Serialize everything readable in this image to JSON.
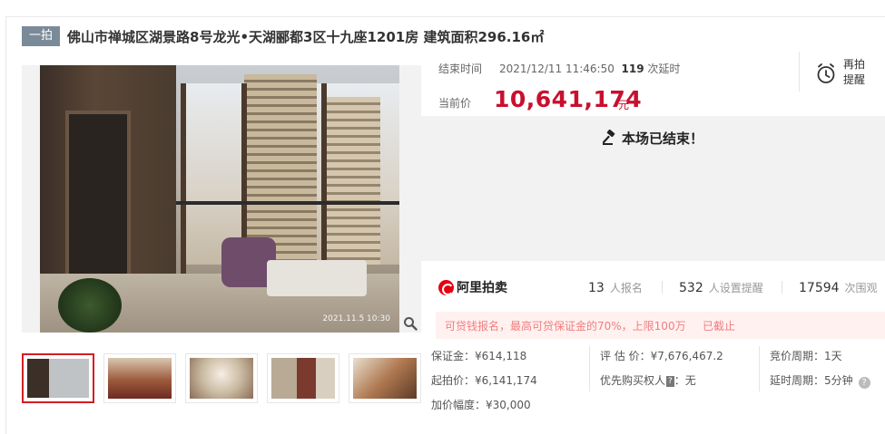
{
  "header": {
    "badge": "一拍",
    "title": "佛山市禅城区湖景路8号龙光•天湖郦都3区十九座1201房 建筑面积296.16㎡"
  },
  "gallery": {
    "photo_stamp": "2021.11.5 10:30",
    "thumbnail_count": 5,
    "active_index": 0
  },
  "auction": {
    "end_label": "结束时间",
    "end_time": "2021/12/11 11:46:50",
    "delay_count": "119",
    "delay_suffix": "次延时",
    "price_label": "当前价",
    "price": "10,641,174",
    "price_unit": "元",
    "remind_label": "再拍提醒",
    "status": "本场已结束！"
  },
  "stats": {
    "brand": "阿里拍卖",
    "signups": "13",
    "signups_label": "人报名",
    "reminders": "532",
    "reminders_label": "人设置提醒",
    "views": "17594",
    "views_label": "次围观"
  },
  "notice": {
    "text": "可贷钱报名，最高可贷保证金的70%，上限100万",
    "status": "已截止"
  },
  "details": {
    "deposit": "保证金：¥614,118",
    "start_price": "起拍价：¥6,141,174",
    "increment": "加价幅度：¥30,000",
    "appraisal": "评 估 价：¥7,676,467.2",
    "priority_label": "优先购买权人",
    "priority_tag": "?",
    "priority_value": "：无",
    "cycle": "竞价周期：1天",
    "delay_cycle": "延时周期：5分钟"
  },
  "colors": {
    "price_red": "#c8102e",
    "badge_gray": "#7a8a99",
    "active_border": "#d31d21",
    "notice_bg": "#fff1f0"
  }
}
